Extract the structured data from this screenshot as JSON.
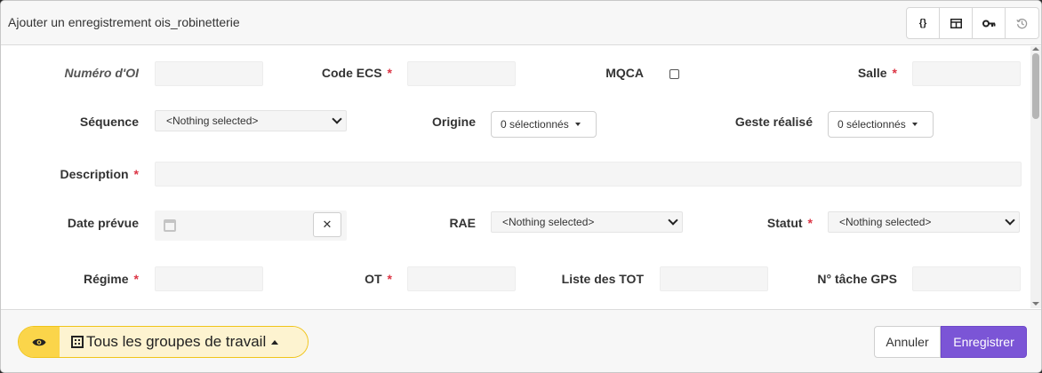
{
  "header": {
    "title": "Ajouter un enregistrement ois_robinetterie",
    "buttons": [
      {
        "icon": "code-braces-icon",
        "glyph": "{}"
      },
      {
        "icon": "table-icon",
        "glyph": ""
      },
      {
        "icon": "key-icon",
        "glyph": ""
      },
      {
        "icon": "history-icon",
        "glyph": ""
      }
    ]
  },
  "form": {
    "numero_oi": {
      "label": "Numéro d'OI",
      "value": ""
    },
    "code_ecs": {
      "label": "Code ECS",
      "required": "*",
      "value": ""
    },
    "mqca": {
      "label": "MQCA",
      "checked": false
    },
    "salle": {
      "label": "Salle",
      "required": "*",
      "value": ""
    },
    "sequence": {
      "label": "Séquence",
      "value": "<Nothing selected>"
    },
    "origine": {
      "label": "Origine",
      "value": "0 sélectionnés"
    },
    "geste": {
      "label": "Geste réalisé",
      "value": "0 sélectionnés"
    },
    "description": {
      "label": "Description",
      "required": "*",
      "value": ""
    },
    "date_prevue": {
      "label": "Date prévue",
      "value": "",
      "clear": "✕"
    },
    "rae": {
      "label": "RAE",
      "value": "<Nothing selected>"
    },
    "statut": {
      "label": "Statut",
      "required": "*",
      "value": "<Nothing selected>"
    },
    "regime": {
      "label": "Régime",
      "required": "*",
      "value": ""
    },
    "ot": {
      "label": "OT",
      "required": "*",
      "value": ""
    },
    "liste_tot": {
      "label": "Liste des TOT",
      "value": ""
    },
    "tache_gps": {
      "label": "N° tâche GPS",
      "value": ""
    }
  },
  "footer": {
    "group_label": "Tous les groupes de travail",
    "cancel_label": "Annuler",
    "save_label": "Enregistrer"
  },
  "colors": {
    "accent": "#7b55d6",
    "required": "#dc3545",
    "group_badge": "#fbd54a"
  }
}
